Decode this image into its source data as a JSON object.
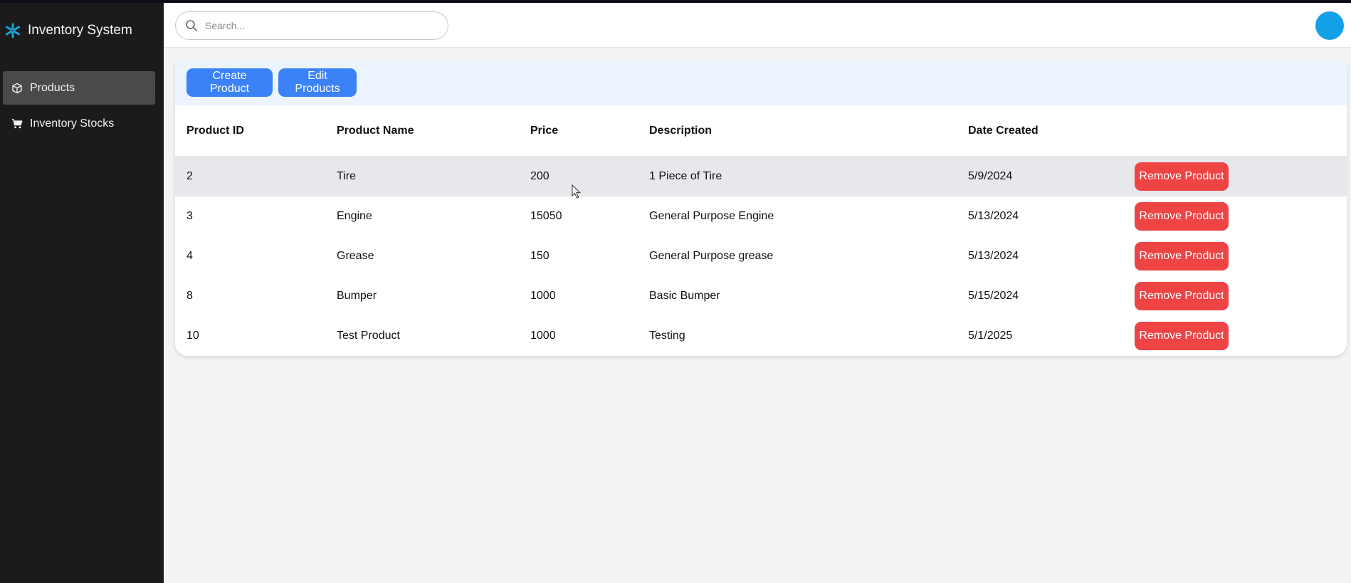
{
  "app": {
    "title": "Inventory System",
    "brand_color": "#1aa3d9"
  },
  "sidebar": {
    "items": [
      {
        "label": "Products",
        "icon": "box-icon",
        "active": true
      },
      {
        "label": "Inventory Stocks",
        "icon": "cart-icon",
        "active": false
      }
    ]
  },
  "header": {
    "search": {
      "placeholder": "Search...",
      "value": ""
    },
    "avatar_color": "#14a0e6"
  },
  "toolbar": {
    "create_label": "Create Product",
    "edit_label": "Edit Products"
  },
  "table": {
    "columns": [
      "Product ID",
      "Product Name",
      "Price",
      "Description",
      "Date Created"
    ],
    "action_label": "Remove Product",
    "rows": [
      {
        "id": "2",
        "name": "Tire",
        "price": "200",
        "description": "1 Piece of Tire",
        "date": "5/9/2024"
      },
      {
        "id": "3",
        "name": "Engine",
        "price": "15050",
        "description": "General Purpose Engine",
        "date": "5/13/2024"
      },
      {
        "id": "4",
        "name": "Grease",
        "price": "150",
        "description": "General Purpose grease",
        "date": "5/13/2024"
      },
      {
        "id": "8",
        "name": "Bumper",
        "price": "1000",
        "description": "Basic Bumper",
        "date": "5/15/2024"
      },
      {
        "id": "10",
        "name": "Test Product",
        "price": "1000",
        "description": "Testing",
        "date": "5/1/2025"
      }
    ]
  },
  "colors": {
    "primary": "#3b82f6",
    "danger": "#ef4444",
    "sidebar": "#1b1b1b"
  }
}
